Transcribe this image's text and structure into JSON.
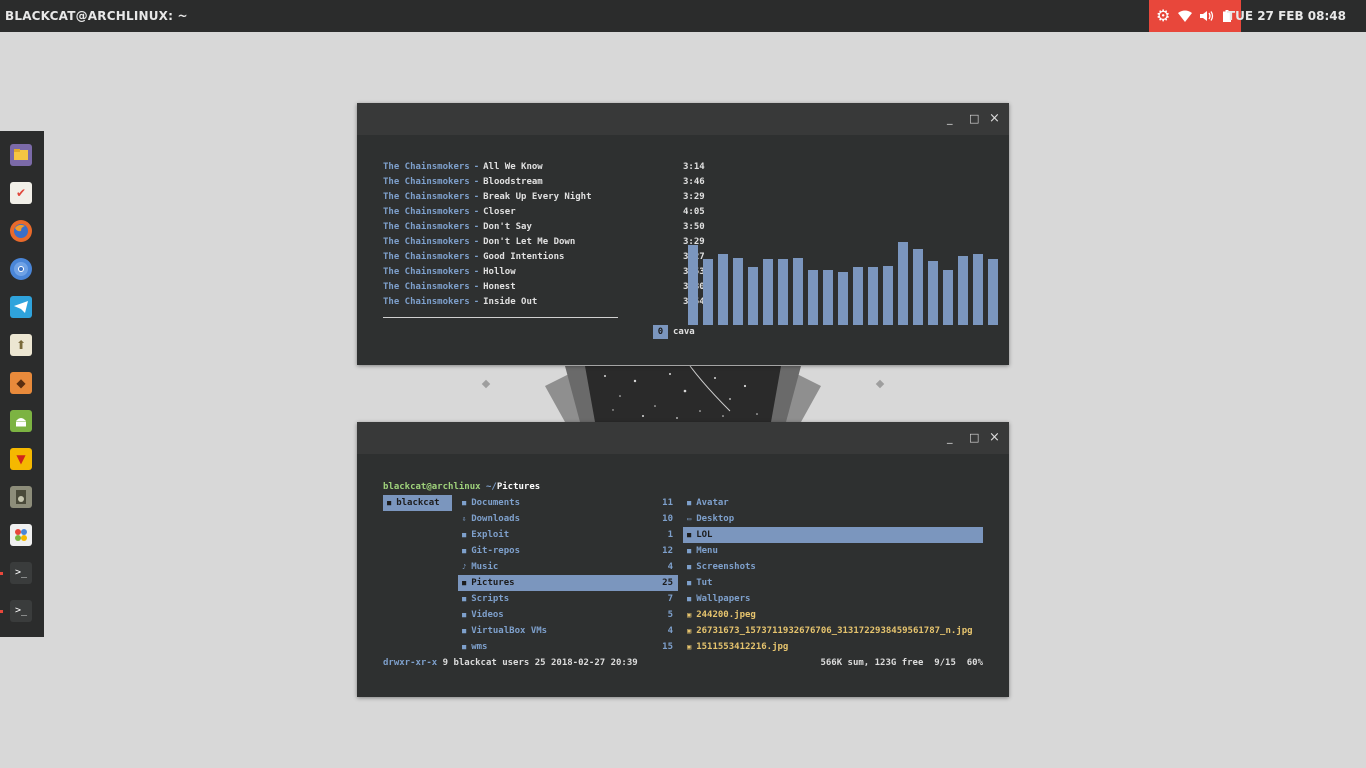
{
  "topbar": {
    "title": "BLACKCAT@ARCHLINUX: ~",
    "clock": "TUE 27 FEB 08:48",
    "tray_icons": [
      "settings-icon",
      "wifi-icon",
      "volume-icon",
      "battery-icon"
    ],
    "tray_color": "#e8473b"
  },
  "dock": {
    "apps": [
      "file-manager-icon",
      "task-manager-icon",
      "firefox-icon",
      "chromium-icon",
      "telegram-icon",
      "package-icon",
      "burp-icon",
      "android-studio-icon",
      "genymotion-icon",
      "media-player-icon",
      "color-picker-icon",
      "terminal-icon",
      "terminal-icon"
    ]
  },
  "music_window": {
    "buttons": {
      "minimize": "_",
      "maximize": "□",
      "close": "×"
    },
    "playlist": [
      {
        "artist": "The Chainsmokers",
        "title": "All We Know",
        "duration": "3:14"
      },
      {
        "artist": "The Chainsmokers",
        "title": "Bloodstream",
        "duration": "3:46"
      },
      {
        "artist": "The Chainsmokers",
        "title": "Break Up Every Night",
        "duration": "3:29"
      },
      {
        "artist": "The Chainsmokers",
        "title": "Closer",
        "duration": "4:05"
      },
      {
        "artist": "The Chainsmokers",
        "title": "Don't Say",
        "duration": "3:50"
      },
      {
        "artist": "The Chainsmokers",
        "title": "Don't Let Me Down",
        "duration": "3:29"
      },
      {
        "artist": "The Chainsmokers",
        "title": "Good Intentions",
        "duration": "3:27"
      },
      {
        "artist": "The Chainsmokers",
        "title": "Hollow",
        "duration": "3:53"
      },
      {
        "artist": "The Chainsmokers",
        "title": "Honest",
        "duration": "3:30"
      },
      {
        "artist": "The Chainsmokers",
        "title": "Inside Out",
        "duration": "3:54"
      }
    ],
    "separator": "-",
    "workspace_number": "0",
    "workspace_label": "cava",
    "visualizer_levels": [
      0.71,
      0.59,
      0.63,
      0.6,
      0.52,
      0.59,
      0.59,
      0.6,
      0.49,
      0.49,
      0.47,
      0.52,
      0.52,
      0.53,
      0.74,
      0.68,
      0.57,
      0.49,
      0.62,
      0.63,
      0.59
    ],
    "bar_color": "#7b96be"
  },
  "file_window": {
    "buttons": {
      "minimize": "_",
      "maximize": "□",
      "close": "×"
    },
    "prompt_user": "blackcat@archlinux",
    "prompt_path": "~/",
    "prompt_dir": "Pictures",
    "parent_column": [
      {
        "icon": "folder-icon",
        "name": "blackcat"
      }
    ],
    "current_column": [
      {
        "icon": "folder-icon",
        "name": "Documents",
        "count": "11"
      },
      {
        "icon": "download-icon",
        "name": "Downloads",
        "count": "10"
      },
      {
        "icon": "folder-icon",
        "name": "Exploit",
        "count": "1"
      },
      {
        "icon": "folder-icon",
        "name": "Git-repos",
        "count": "12"
      },
      {
        "icon": "music-icon",
        "name": "Music",
        "count": "4"
      },
      {
        "icon": "folder-icon",
        "name": "Pictures",
        "count": "25"
      },
      {
        "icon": "folder-icon",
        "name": "Scripts",
        "count": "7"
      },
      {
        "icon": "folder-icon",
        "name": "Videos",
        "count": "5"
      },
      {
        "icon": "folder-icon",
        "name": "VirtualBox VMs",
        "count": "4"
      },
      {
        "icon": "folder-icon",
        "name": "wms",
        "count": "15"
      }
    ],
    "preview_column": [
      {
        "icon": "folder-icon",
        "name": "Avatar",
        "kind": "dir"
      },
      {
        "icon": "desktop-icon",
        "name": "Desktop",
        "kind": "dir"
      },
      {
        "icon": "folder-icon",
        "name": "LOL",
        "kind": "dir"
      },
      {
        "icon": "folder-icon",
        "name": "Menu",
        "kind": "dir"
      },
      {
        "icon": "folder-icon",
        "name": "Screenshots",
        "kind": "dir"
      },
      {
        "icon": "folder-icon",
        "name": "Tut",
        "kind": "dir"
      },
      {
        "icon": "folder-icon",
        "name": "Wallpapers",
        "kind": "dir"
      },
      {
        "icon": "image-icon",
        "name": "244200.jpeg",
        "kind": "file"
      },
      {
        "icon": "image-icon",
        "name": "26731673_1573711932676706_3131722938459561787_n.jpg",
        "kind": "file"
      },
      {
        "icon": "image-icon",
        "name": "1511553412216.jpg",
        "kind": "file"
      }
    ],
    "status_perms": "drwxr-xr-x",
    "status_info": "9 blackcat users 25 2018-02-27 20:39",
    "status_right": "566K sum, 123G free  9/15  60%",
    "highlight_color": "#7b96be"
  }
}
